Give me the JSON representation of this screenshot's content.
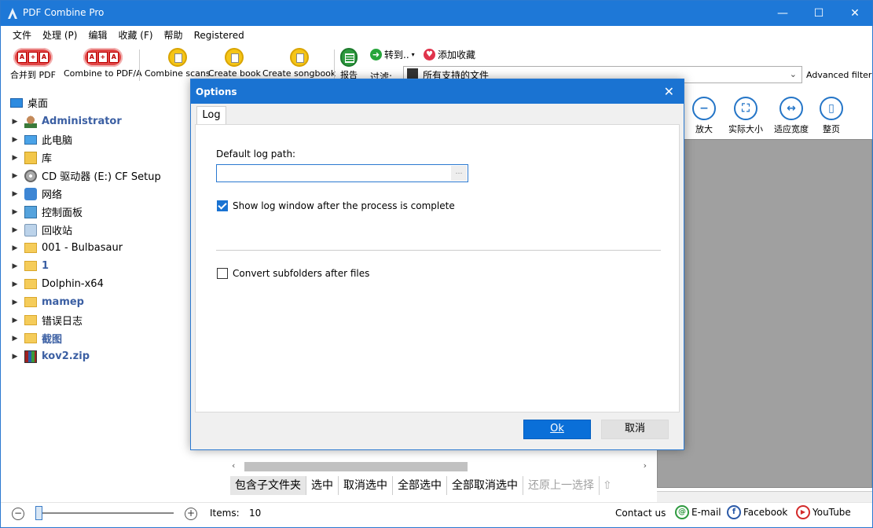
{
  "app": {
    "title": "PDF Combine Pro"
  },
  "window_controls": {
    "minimize": "—",
    "maximize": "☐",
    "close": "✕"
  },
  "menu": [
    "文件",
    "处理 (P)",
    "编辑",
    "收藏 (F)",
    "帮助",
    "Registered"
  ],
  "toolbar": {
    "combine_pdf": "合并到 PDF",
    "combine_pdfa": "Combine to PDF/A",
    "combine_scans": "Combine scans",
    "create_book": "Create book",
    "create_songbook": "Create songbook",
    "report": "报告",
    "goto": "转到..",
    "add_favorite": "添加收藏",
    "filter_label": "过滤:",
    "filter_value": "所有支持的文件",
    "advanced_filter": "Advanced filter"
  },
  "tree": {
    "root": "桌面",
    "items": [
      {
        "label": "Administrator",
        "icon": "user-icon",
        "bold": true
      },
      {
        "label": "此电脑",
        "icon": "computer-icon",
        "bold": false
      },
      {
        "label": "库",
        "icon": "library-icon",
        "bold": false
      },
      {
        "label": "CD 驱动器 (E:) CF Setup",
        "icon": "cd-drive-icon",
        "bold": false
      },
      {
        "label": "网络",
        "icon": "network-icon",
        "bold": false
      },
      {
        "label": "控制面板",
        "icon": "control-panel-icon",
        "bold": false
      },
      {
        "label": "回收站",
        "icon": "recycle-bin-icon",
        "bold": false
      },
      {
        "label": "001 - Bulbasaur",
        "icon": "folder-icon",
        "bold": false
      },
      {
        "label": "1",
        "icon": "folder-icon",
        "bold": true
      },
      {
        "label": "Dolphin-x64",
        "icon": "folder-icon",
        "bold": false
      },
      {
        "label": "mamep",
        "icon": "folder-icon",
        "bold": true
      },
      {
        "label": "错误日志",
        "icon": "folder-icon",
        "bold": false
      },
      {
        "label": "截图",
        "icon": "folder-icon",
        "bold": true
      },
      {
        "label": "kov2.zip",
        "icon": "zip-archive-icon",
        "bold": true
      }
    ]
  },
  "view_tools": {
    "zoom_in": "放大",
    "actual_size": "实际大小",
    "fit_width": "适应宽度",
    "full_page": "整页"
  },
  "selection_bar": {
    "include_subfolders": "包含子文件夹",
    "select": "选中",
    "deselect": "取消选中",
    "select_all": "全部选中",
    "deselect_all": "全部取消选中",
    "restore_previous": "还原上一选择"
  },
  "status": {
    "items_label": "Items:",
    "items_count": "10",
    "contact": "Contact us",
    "email": "E-mail",
    "facebook": "Facebook",
    "youtube": "YouTube"
  },
  "dialog": {
    "title": "Options",
    "close": "✕",
    "tab": "Log",
    "log_path_label": "Default log path:",
    "log_path_value": "",
    "show_log_window": "Show log window after the process is complete",
    "show_log_window_checked": true,
    "convert_subfolders": "Convert subfolders after files",
    "convert_subfolders_checked": false,
    "ok": "Ok",
    "cancel": "取消"
  },
  "colors": {
    "accent": "#1e78d7",
    "ok_button": "#0a6fd8",
    "preview_bg": "#a0a0a0"
  }
}
